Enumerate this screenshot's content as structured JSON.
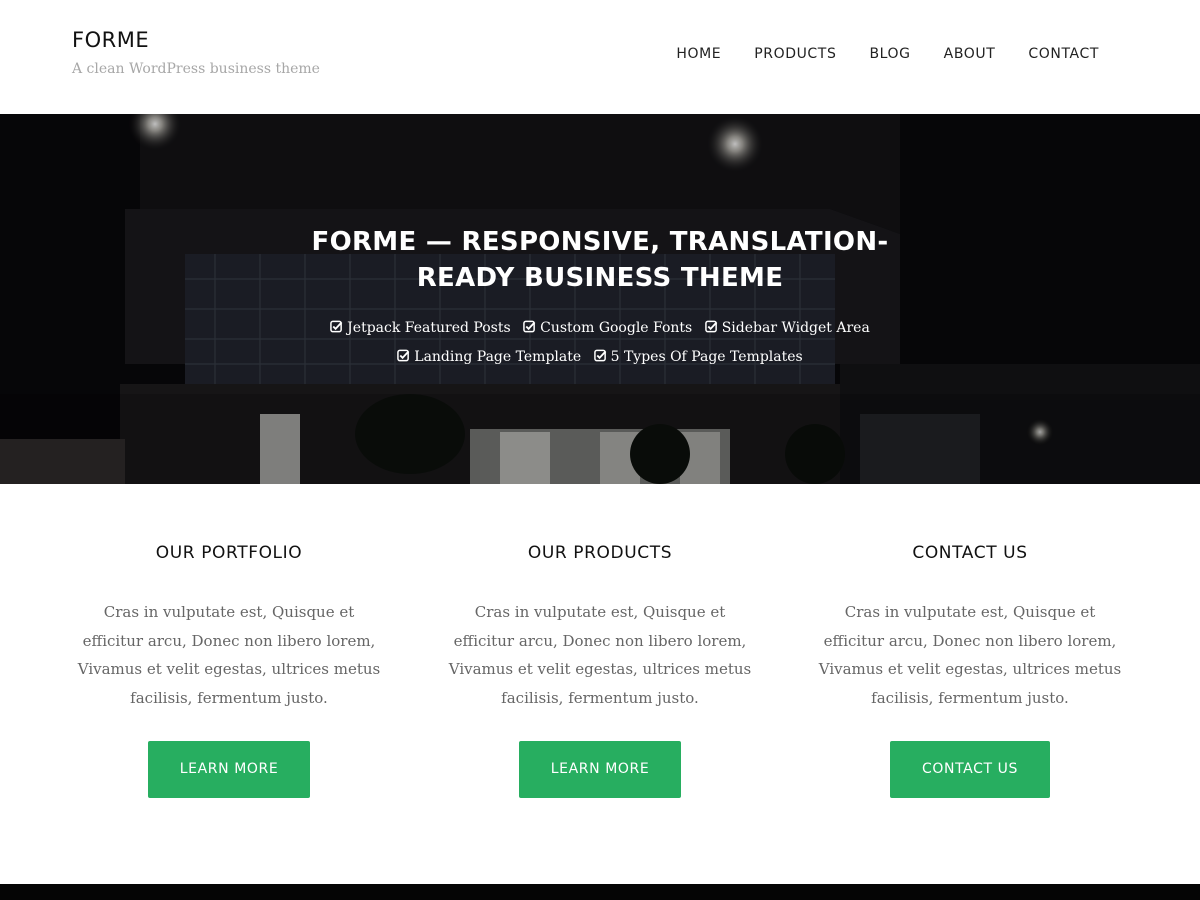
{
  "header": {
    "site_title": "FORME",
    "tagline": "A clean WordPress business theme",
    "nav": [
      {
        "label": "HOME"
      },
      {
        "label": "PRODUCTS"
      },
      {
        "label": "BLOG"
      },
      {
        "label": "ABOUT"
      },
      {
        "label": "CONTACT"
      }
    ]
  },
  "hero": {
    "title": "FORME — RESPONSIVE, TRANSLATION-READY BUSINESS THEME",
    "features": [
      {
        "label": "Jetpack Featured Posts",
        "icon": "check-square-icon"
      },
      {
        "label": "Custom Google Fonts",
        "icon": "check-square-icon"
      },
      {
        "label": "Sidebar Widget Area",
        "icon": "check-square-icon"
      },
      {
        "label": "Landing Page Template",
        "icon": "check-square-icon"
      },
      {
        "label": "5 Types Of Page Templates",
        "icon": "check-square-icon"
      }
    ]
  },
  "columns": [
    {
      "title": "OUR PORTFOLIO",
      "text": "Cras in vulputate est, Quisque et efficitur arcu, Donec non libero lorem, Vivamus et velit egestas, ultrices metus facilisis, fermentum justo.",
      "button": "LEARN MORE"
    },
    {
      "title": "OUR PRODUCTS",
      "text": "Cras in vulputate est, Quisque et efficitur arcu, Donec non libero lorem, Vivamus et velit egestas, ultrices metus facilisis, fermentum justo.",
      "button": "LEARN MORE"
    },
    {
      "title": "CONTACT US",
      "text": "Cras in vulputate est, Quisque et efficitur arcu, Donec non libero lorem, Vivamus et velit egestas, ultrices metus facilisis, fermentum justo.",
      "button": "CONTACT US"
    }
  ],
  "colors": {
    "accent": "#27ae60",
    "hero_bg": "#0d0c0f",
    "footer": "#050505",
    "tagline": "#a7a7a7",
    "body_text": "#666666"
  }
}
